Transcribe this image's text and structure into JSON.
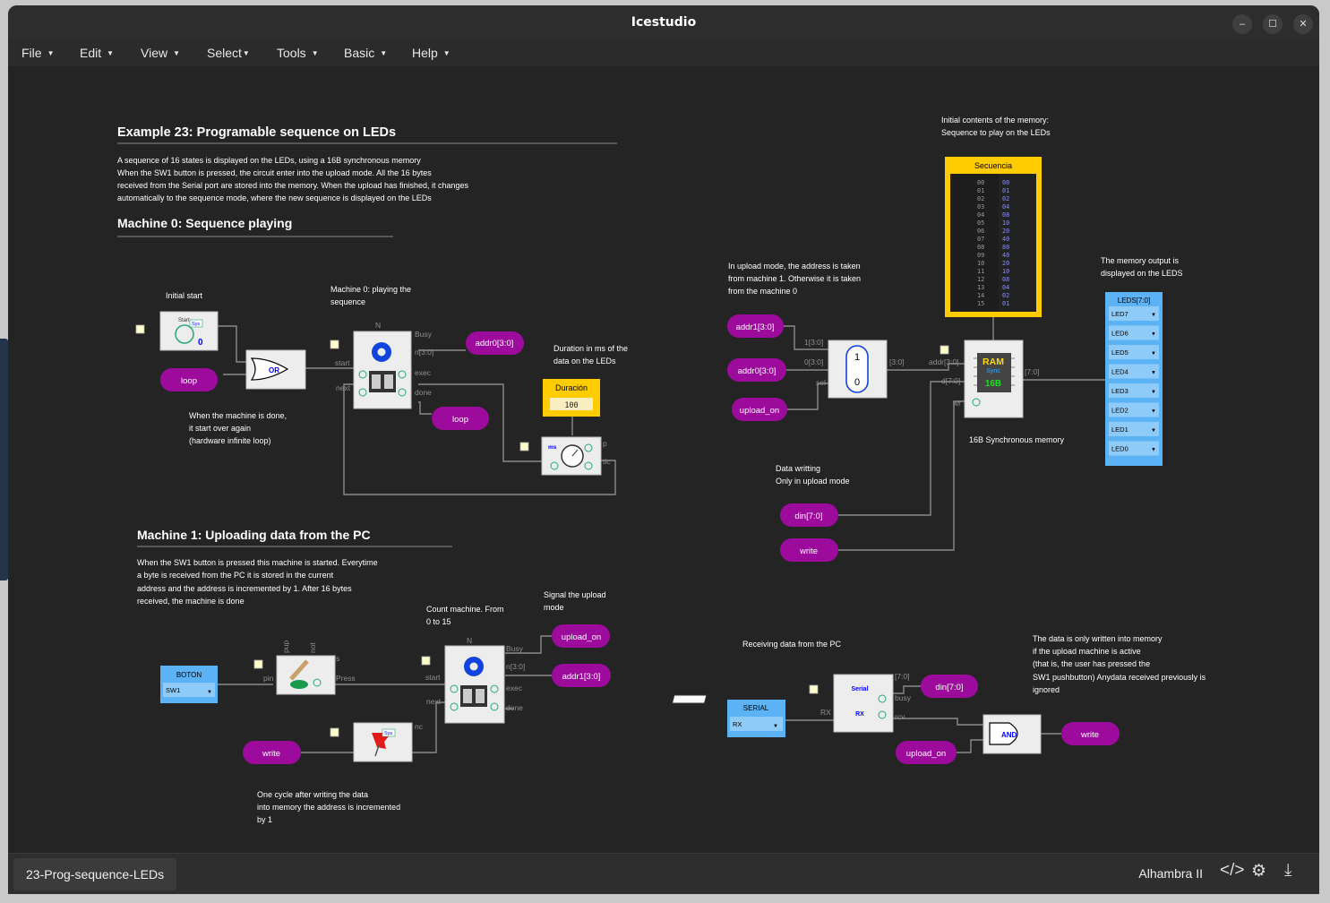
{
  "window": {
    "title": "Icestudio",
    "minimize_icon": "minimize-icon",
    "maximize_icon": "maximize-icon",
    "close_icon": "close-icon"
  },
  "menu": [
    {
      "label": "File"
    },
    {
      "label": "Edit"
    },
    {
      "label": "View"
    },
    {
      "label": "Select"
    },
    {
      "label": "Tools"
    },
    {
      "label": "Basic"
    },
    {
      "label": "Help"
    }
  ],
  "canvas": {
    "heading_main": "Example 23: Programable sequence on LEDs",
    "desc_lines": [
      "A sequence of 16 states is displayed on the LEDs, using a 16B synchronous memory",
      "When the SW1 button is pressed, the circuit enter into the upload mode. All the 16 bytes",
      "received from the Serial port are stored into the memory. When the upload has finished, it changes",
      "automatically to the sequence mode, where the new sequence is displayed on the LEDs"
    ],
    "heading_m0": "Machine 0: Sequence playing",
    "heading_m1": "Machine 1: Uploading data from the PC",
    "m1_desc": [
      "When the SW1 button is pressed this machine is started. Everytime",
      "a byte is received from the PC it is stored in the current",
      "address and the address is incremented by 1. After 16 bytes",
      "received, the machine is done"
    ],
    "notes": {
      "initial_start": "Initial start",
      "m0_playing": [
        "Machine 0: playing the",
        "sequence"
      ],
      "machine_done": [
        "When the machine is done,",
        "it start over again",
        "(hardware infinite loop)"
      ],
      "duration": [
        "Duration in ms of the",
        "data on the LEDs"
      ],
      "count_machine": [
        "Count machine. From",
        "0 to 15"
      ],
      "signal_upload": [
        "Signal the upload",
        "mode"
      ],
      "one_cycle": [
        "One cycle after writing the data",
        "into memory the address is incremented",
        "by 1"
      ],
      "memory_initial": [
        "Initial contents of the memory:",
        "Sequence to play on the LEDs"
      ],
      "upload_mode": [
        "In upload mode, the address is taken",
        "from machine 1. Otherwise it is taken",
        "from the machine 0"
      ],
      "memory_output": [
        "The memory output is",
        "displayed on the LEDS"
      ],
      "sync_memory": "16B Synchronous memory",
      "data_writing": [
        "Data writting",
        "Only in upload mode"
      ],
      "receiving": "Receiving data from the PC",
      "only_written": [
        "The data is only written into memory",
        "if the upload machine is active",
        "(that is, the user has pressed the",
        "SW1 pushbutton) Anydata received previously is",
        "ignored"
      ]
    },
    "labels": {
      "loop": "loop",
      "addr0": "addr0[3:0]",
      "addr1": "addr1[3:0]",
      "upload_on": "upload_on",
      "write": "write",
      "din": "din[7:0]",
      "duration_title": "Duración",
      "duration_value": "100",
      "secuencia_title": "Secuencia",
      "boton_title": "BOTON",
      "boton_value": "SW1",
      "serial_title": "SERIAL",
      "serial_value": "RX",
      "leds_title": "LEDS[7:0]",
      "or": "OR",
      "and": "AND",
      "ms": "ms",
      "ram": "RAM",
      "sync": "Sync",
      "size16b": "16B",
      "start_sys": "Start",
      "sys": "Sys",
      "serial_block": "Serial",
      "rx_block": "RX"
    },
    "ports": {
      "busy": "Busy",
      "n": "n[3:0]",
      "start": "start",
      "next": "next",
      "exec": "exec",
      "done": "done",
      "p": "p",
      "tic": "tic",
      "pin": "pin",
      "press": "Press",
      "s": "s",
      "nc": "nc",
      "pup": "pup",
      "not": "not",
      "n_top": "N",
      "in1": "1[3:0]",
      "in0": "0[3:0]",
      "sel": "sel",
      "out30": "[3:0]",
      "addr": "addr[3:0]",
      "d": "d[7:0]",
      "wr": "wr",
      "out70": "[7:0]",
      "busy_s": "busy",
      "rcv": "rcv",
      "rx": "RX",
      "mux1": "1",
      "mux0": "0"
    },
    "memory_rows": [
      [
        "00",
        "00"
      ],
      [
        "01",
        "01"
      ],
      [
        "02",
        "02"
      ],
      [
        "03",
        "04"
      ],
      [
        "04",
        "08"
      ],
      [
        "05",
        "10"
      ],
      [
        "06",
        "20"
      ],
      [
        "07",
        "40"
      ],
      [
        "08",
        "80"
      ],
      [
        "09",
        "40"
      ],
      [
        "10",
        "20"
      ],
      [
        "11",
        "10"
      ],
      [
        "12",
        "08"
      ],
      [
        "13",
        "04"
      ],
      [
        "14",
        "02"
      ],
      [
        "15",
        "01"
      ]
    ],
    "leds": [
      "LED7",
      "LED6",
      "LED5",
      "LED4",
      "LED3",
      "LED2",
      "LED1",
      "LED0"
    ]
  },
  "bottom": {
    "file_tab": "23-Prog-sequence-LEDs",
    "board": "Alhambra II",
    "icons": [
      "code-icon",
      "settings-gear-icon",
      "download-icon"
    ]
  },
  "colors": {
    "magenta": "#9c0b9c",
    "yellow": "#ffcc00",
    "blue": "#5bb3f5",
    "bg": "#242424"
  }
}
